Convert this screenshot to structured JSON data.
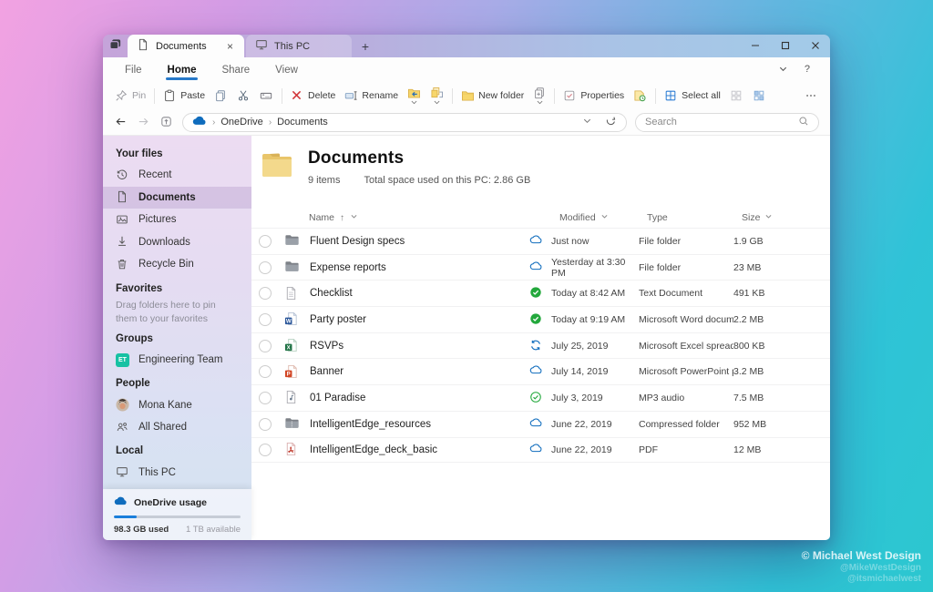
{
  "accent_colors": {
    "onedrive_blue": "#0f6cbd",
    "home_underline": "#2779c9",
    "sync_green": "#23a83c",
    "delete_red": "#d13438",
    "folder_yellow": "#f7d66b",
    "team_teal": "#17c1a3"
  },
  "tabstrip": {
    "tabs": [
      {
        "label": "Documents",
        "icon": "document-icon",
        "active": true,
        "closable": true
      },
      {
        "label": "This PC",
        "icon": "monitor-icon",
        "active": false,
        "closable": false
      }
    ],
    "close_glyph": "×"
  },
  "menu": {
    "items": [
      {
        "label": "File",
        "active": false
      },
      {
        "label": "Home",
        "active": true
      },
      {
        "label": "Share",
        "active": false
      },
      {
        "label": "View",
        "active": false
      }
    ],
    "help_glyph": "?"
  },
  "toolbar": {
    "groups": [
      [
        {
          "icon": "pin-icon",
          "label": "Pin",
          "disabled": true
        }
      ],
      [
        {
          "icon": "paste-icon",
          "label": "Paste"
        },
        {
          "icon": "copy-icon"
        },
        {
          "icon": "cut-icon"
        },
        {
          "icon": "copy-path-icon"
        }
      ],
      [
        {
          "icon": "delete-icon",
          "label": "Delete"
        },
        {
          "icon": "rename-icon",
          "label": "Rename"
        },
        {
          "icon": "move-to-icon",
          "dropdown": true
        },
        {
          "icon": "copy-to-icon",
          "dropdown": true
        }
      ],
      [
        {
          "icon": "new-folder-icon",
          "label": "New folder"
        },
        {
          "icon": "new-item-icon",
          "dropdown": true
        }
      ],
      [
        {
          "icon": "properties-icon",
          "label": "Properties"
        },
        {
          "icon": "history-icon"
        }
      ],
      [
        {
          "icon": "select-all-icon",
          "label": "Select all"
        },
        {
          "icon": "select-none-icon"
        },
        {
          "icon": "invert-selection-icon"
        }
      ],
      [
        {
          "icon": "more-icon"
        }
      ]
    ]
  },
  "addressbar": {
    "breadcrumb": [
      "OneDrive",
      "Documents"
    ],
    "search_placeholder": "Search"
  },
  "sidebar": {
    "sections": [
      {
        "header": "Your files",
        "items": [
          {
            "label": "Recent",
            "icon": "recent-icon"
          },
          {
            "label": "Documents",
            "icon": "document-icon",
            "selected": true
          },
          {
            "label": "Pictures",
            "icon": "pictures-icon"
          },
          {
            "label": "Downloads",
            "icon": "downloads-icon"
          },
          {
            "label": "Recycle Bin",
            "icon": "recycle-bin-icon"
          }
        ]
      },
      {
        "header": "Favorites",
        "hint": "Drag folders here to pin them to your favorites",
        "items": []
      },
      {
        "header": "Groups",
        "items": [
          {
            "label": "Engineering Team",
            "icon": "engineering-team-avatar",
            "avatar_text": "ET"
          }
        ]
      },
      {
        "header": "People",
        "items": [
          {
            "label": "Mona Kane",
            "icon": "mona-kane-avatar"
          },
          {
            "label": "All Shared",
            "icon": "people-icon"
          }
        ]
      },
      {
        "header": "Local",
        "items": [
          {
            "label": "This PC",
            "icon": "monitor-icon"
          }
        ]
      }
    ],
    "usage": {
      "title": "OneDrive usage",
      "icon": "onedrive-cloud-icon",
      "used_label": "98.3 GB used",
      "available_label": "1 TB available",
      "percent_used": 18
    }
  },
  "content": {
    "title": "Documents",
    "items_count": "9 items",
    "space_used": "Total space used on this PC: 2.86 GB",
    "columns": {
      "name": "Name",
      "modified": "Modified",
      "type": "Type",
      "size": "Size"
    },
    "rows": [
      {
        "name": "Fluent Design specs",
        "icon": "folder-icon",
        "status": "cloud-icon",
        "modified": "Just now",
        "type": "File folder",
        "size": "1.9 GB"
      },
      {
        "name": "Expense reports",
        "icon": "folder-icon",
        "status": "cloud-icon",
        "modified": "Yesterday at 3:30 PM",
        "type": "File folder",
        "size": "23 MB"
      },
      {
        "name": "Checklist",
        "icon": "text-doc-icon",
        "status": "synced-filled-icon",
        "modified": "Today at 8:42 AM",
        "type": "Text Document",
        "size": "491 KB"
      },
      {
        "name": "Party poster",
        "icon": "word-icon",
        "status": "synced-filled-icon",
        "modified": "Today at 9:19 AM",
        "type": "Microsoft Word docum...",
        "size": "2.2 MB"
      },
      {
        "name": "RSVPs",
        "icon": "excel-icon",
        "status": "syncing-icon",
        "modified": "July 25, 2019",
        "type": "Microsoft Excel spreads...",
        "size": "800 KB"
      },
      {
        "name": "Banner",
        "icon": "powerpoint-icon",
        "status": "cloud-icon",
        "modified": "July 14, 2019",
        "type": "Microsoft PowerPoint p...",
        "size": "3.2 MB"
      },
      {
        "name": "01 Paradise",
        "icon": "audio-icon",
        "status": "synced-outline-icon",
        "modified": "July 3, 2019",
        "type": "MP3 audio",
        "size": "7.5 MB"
      },
      {
        "name": "IntelligentEdge_resources",
        "icon": "zip-icon",
        "status": "cloud-icon",
        "modified": "June 22, 2019",
        "type": "Compressed folder",
        "size": "952 MB"
      },
      {
        "name": "IntelligentEdge_deck_basic",
        "icon": "pdf-icon",
        "status": "cloud-icon",
        "modified": "June 22, 2019",
        "type": "PDF",
        "size": "12 MB"
      }
    ]
  },
  "watermark": {
    "line1": "© Michael West Design",
    "line2": "@MikeWestDesign",
    "line3": "@itsmichaelwest"
  }
}
